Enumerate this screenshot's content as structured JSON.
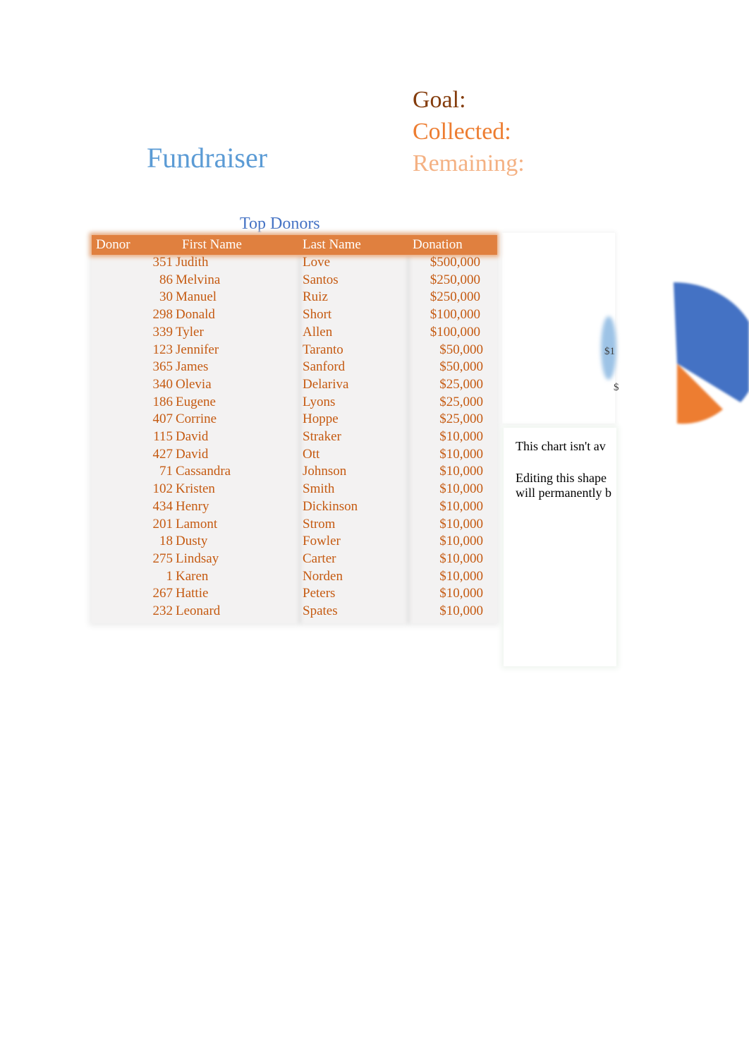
{
  "title": "Fundraiser",
  "summary": {
    "goal_label": "Goal:",
    "collected_label": "Collected:",
    "remaining_label": "Remaining:"
  },
  "table": {
    "title": "Top Donors",
    "headers": [
      "Donor",
      "First Name",
      "Last Name",
      "Donation"
    ],
    "rows": [
      [
        "351",
        "Judith",
        "Love",
        "$500,000"
      ],
      [
        "86",
        "Melvina",
        "Santos",
        "$250,000"
      ],
      [
        "30",
        "Manuel",
        "Ruiz",
        "$250,000"
      ],
      [
        "298",
        "Donald",
        "Short",
        "$100,000"
      ],
      [
        "339",
        "Tyler",
        "Allen",
        "$100,000"
      ],
      [
        "123",
        "Jennifer",
        "Taranto",
        "$50,000"
      ],
      [
        "365",
        "James",
        "Sanford",
        "$50,000"
      ],
      [
        "340",
        "Olevia",
        "Delariva",
        "$25,000"
      ],
      [
        "186",
        "Eugene",
        "Lyons",
        "$25,000"
      ],
      [
        "407",
        "Corrine",
        "Hoppe",
        "$25,000"
      ],
      [
        "115",
        "David",
        "Straker",
        "$10,000"
      ],
      [
        "427",
        "David",
        "Ott",
        "$10,000"
      ],
      [
        "71",
        "Cassandra",
        "Johnson",
        "$10,000"
      ],
      [
        "102",
        "Kristen",
        "Smith",
        "$10,000"
      ],
      [
        "434",
        "Henry",
        "Dickinson",
        "$10,000"
      ],
      [
        "201",
        "Lamont",
        "Strom",
        "$10,000"
      ],
      [
        "18",
        "Dusty",
        "Fowler",
        "$10,000"
      ],
      [
        "275",
        "Lindsay",
        "Carter",
        "$10,000"
      ],
      [
        "1",
        "Karen",
        "Norden",
        "$10,000"
      ],
      [
        "267",
        "Hattie",
        "Peters",
        "$10,000"
      ],
      [
        "232",
        "Leonard",
        "Spates",
        "$10,000"
      ]
    ]
  },
  "chart": {
    "label_1": "$1",
    "label_2": "$",
    "colors": {
      "blue": "#4472c4",
      "orange": "#ed7d31",
      "light_blue": "#9dc3e6"
    }
  },
  "notice": {
    "line1": "This chart isn't av",
    "line2": "Editing this shape",
    "line3": "will permanently b"
  },
  "colors": {
    "header": "#e0803f",
    "text": "#c55a11",
    "title": "#5b9bd5"
  }
}
